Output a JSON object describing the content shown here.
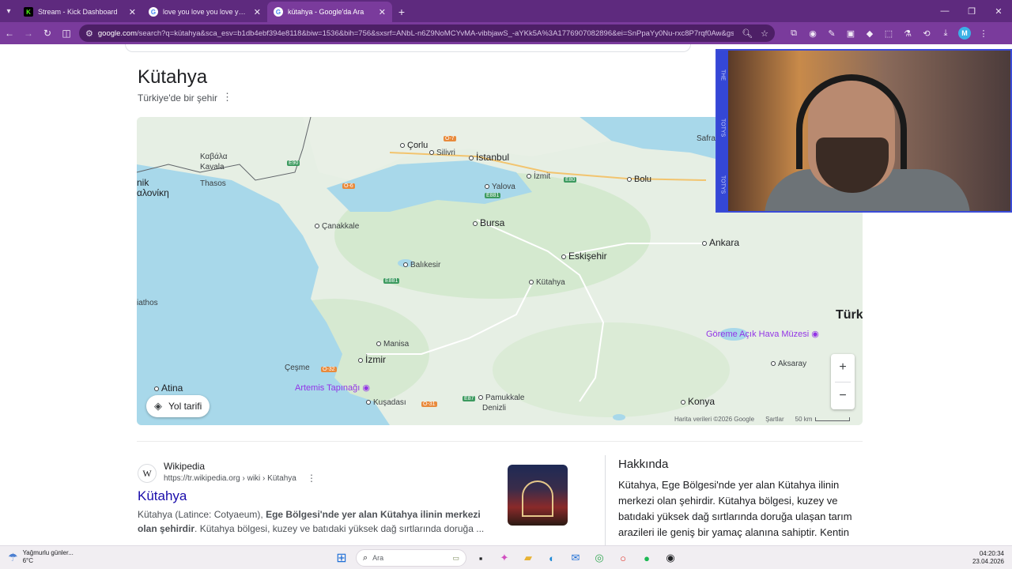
{
  "browser": {
    "tabs": [
      {
        "label": "Stream - Kick Dashboard",
        "favicon": "K",
        "favicon_color": "#53fc18",
        "active": false
      },
      {
        "label": "love you love you love you şarkı",
        "favicon": "G",
        "favicon_color": "#ffffff",
        "active": false
      },
      {
        "label": "kütahya - Google'da Ara",
        "favicon": "G",
        "favicon_color": "#ffffff",
        "active": true
      }
    ],
    "url_host": "google.com",
    "url_rest": "/search?q=kütahya&sca_esv=b1db4ebf394e8118&biw=1536&bih=756&sxsrf=ANbL-n6Z9NoMCYvMA-vibbjawS_-aYKk5A%3A1776907082896&ei=SnPpaYy0Nu-rxc8P7rqf0Aw&gs_s...",
    "theme_color": "#7a3b9c"
  },
  "entity": {
    "title": "Kütahya",
    "subtitle": "Türkiye'de bir şehir"
  },
  "map": {
    "labels": {
      "corlu": "Çorlu",
      "silivri": "Silivri",
      "istanbul": "İstanbul",
      "kavala": "Καβάλα",
      "kavala_lat": "Kavala",
      "thasos": "Thasos",
      "nik": "nik",
      "aloniki": "αλονίκη",
      "izmit": "İzmit",
      "bolu": "Bolu",
      "safra": "Safra",
      "yalova": "Yalova",
      "canakkale": "Çanakkale",
      "bursa": "Bursa",
      "ankara": "Ankara",
      "eskisehir": "Eskişehir",
      "balikesir": "Balıkesir",
      "kutahya": "Kütahya",
      "athos": "iathos",
      "turk": "Türk",
      "goreme": "Göreme Açık Hava Müzesi",
      "manisa": "Manisa",
      "izmir": "İzmir",
      "cesme": "Çeşme",
      "aksaray": "Aksaray",
      "atina": "Atina",
      "artemis": "Artemis Tapınağı",
      "pamukkale": "Pamukkale",
      "kusadasi": "Kuşadası",
      "denizli": "Denizli",
      "konya": "Konya"
    },
    "roads": {
      "o7": "O-7",
      "e90": "E90",
      "o6": "O-6",
      "e881a": "E881",
      "e80": "E80",
      "e881b": "E881",
      "o32": "O-32",
      "e87": "E87",
      "o31": "O-31"
    },
    "directions_label": "Yol tarifi",
    "attribution": "Harita verileri ©2026 Google",
    "terms": "Şartlar",
    "scale": "50 km",
    "zoom_in": "+",
    "zoom_out": "−"
  },
  "result": {
    "site_name": "Wikipedia",
    "breadcrumb": "https://tr.wikipedia.org › wiki › Kütahya",
    "title": "Kütahya",
    "snippet_1": "Kütahya (Latince: Cotyaeum), ",
    "snippet_bold_1": "Ege Bölgesi'nde yer alan Kütahya ilinin merkezi olan şehirdir",
    "snippet_2": ". Kütahya bölgesi, kuzey ve batıdaki yüksek dağ sırtlarında doruğa ..."
  },
  "about": {
    "heading": "Hakkında",
    "text": "Kütahya, Ege Bölgesi'nde yer alan Kütahya ilinin merkezi olan şehirdir. Kütahya bölgesi, kuzey ve batıdaki yüksek dağ sırtlarında doruğa ulaşan tarım arazileri ile geniş bir yamaç alanına sahiptir. Kentin"
  },
  "webcam": {
    "sidebar_labels": [
      "THE",
      "TOTYS",
      "TOTYS"
    ]
  },
  "taskbar": {
    "weather_line1": "Yağmurlu günler...",
    "weather_line2": "6°C",
    "search_placeholder": "Ara",
    "time": "04:20:34",
    "date": "23.04.2026"
  }
}
